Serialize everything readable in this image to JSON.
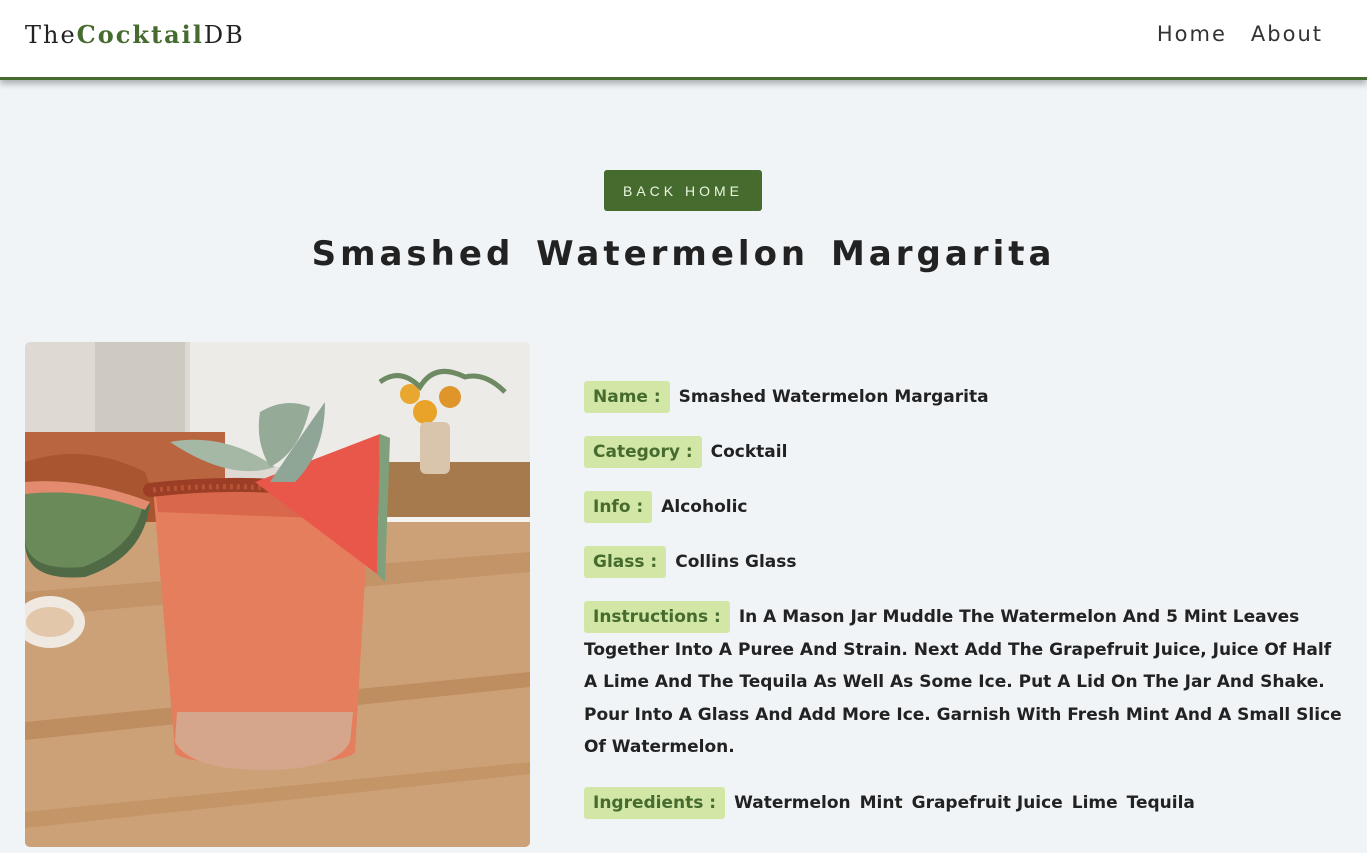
{
  "navbar": {
    "logo": {
      "prefix": "The",
      "middle": "Cocktail",
      "suffix": "DB"
    },
    "links": [
      {
        "label": "Home"
      },
      {
        "label": "About"
      }
    ]
  },
  "back_button": "BACK HOME",
  "title": "Smashed Watermelon Margarita",
  "details": {
    "name": {
      "label": "Name :",
      "value": "Smashed Watermelon Margarita"
    },
    "category": {
      "label": "Category :",
      "value": "Cocktail"
    },
    "info": {
      "label": "Info :",
      "value": "Alcoholic"
    },
    "glass": {
      "label": "Glass :",
      "value": "Collins Glass"
    },
    "instructions": {
      "label": "Instructions :",
      "value": "In A Mason Jar Muddle The Watermelon And 5 Mint Leaves Together Into A Puree And Strain. Next Add The Grapefruit Juice, Juice Of Half A Lime And The Tequila As Well As Some Ice. Put A Lid On The Jar And Shake. Pour Into A Glass And Add More Ice. Garnish With Fresh Mint And A Small Slice Of Watermelon."
    },
    "ingredients": {
      "label": "Ingredients :",
      "items": [
        "Watermelon",
        "Mint",
        "Grapefruit Juice",
        "Lime",
        "Tequila"
      ]
    }
  },
  "colors": {
    "accent": "#466b2e",
    "label_bg": "#d2e6a6",
    "page_bg": "#f0f4f7"
  }
}
